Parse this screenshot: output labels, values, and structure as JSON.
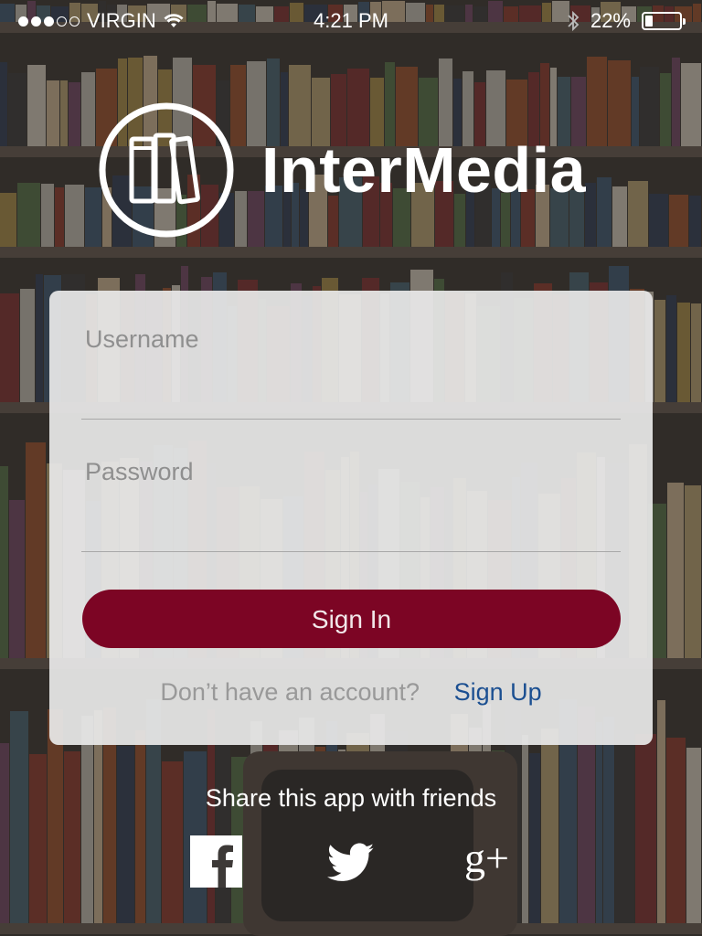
{
  "status_bar": {
    "carrier": "VIRGIN",
    "signal_bars_filled": 3,
    "signal_bars_total": 5,
    "time": "4:21 PM",
    "battery_percent": "22%"
  },
  "app": {
    "name": "InterMedia"
  },
  "login": {
    "username_placeholder": "Username",
    "password_placeholder": "Password",
    "signin_label": "Sign In",
    "no_account_text": "Don’t have an account?",
    "signup_label": "Sign Up"
  },
  "share": {
    "title": "Share this app with friends",
    "icons": [
      "facebook-icon",
      "twitter-icon",
      "google-plus-icon"
    ],
    "google_plus_text": "g+"
  },
  "colors": {
    "signin_button": "#7c0524",
    "signup_link": "#1b4f91",
    "card_background": "#e8e8e8"
  }
}
